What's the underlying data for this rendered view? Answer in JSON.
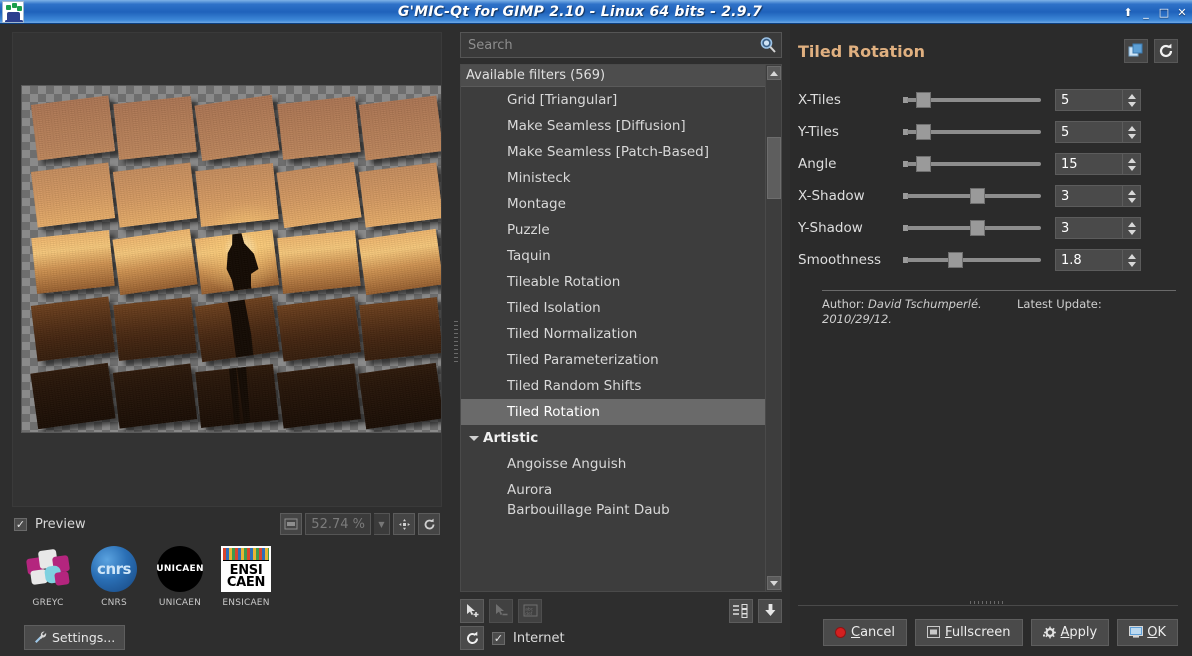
{
  "window": {
    "title": "G'MIC-Qt for GIMP 2.10 - Linux 64 bits - 2.9.7",
    "buttons": {
      "rollup": "⬆",
      "minimize": "_",
      "maximize": "□",
      "close": "✕"
    },
    "app_icon": "gmic-logo-icon"
  },
  "preview": {
    "checkbox_label": "Preview",
    "checked": true,
    "zoom_level": "52.74 %",
    "fit_button": "fit-icon",
    "zoom_in_button": "zoom-in-icon",
    "reset_zoom_button": "reset-zoom-icon"
  },
  "logos": [
    {
      "name": "GREYC",
      "caption": "GREYC"
    },
    {
      "name": "CNRS",
      "caption": "CNRS",
      "text": "cnrs"
    },
    {
      "name": "UNICAEN",
      "caption": "UNICAEN",
      "text": "UNICAEN"
    },
    {
      "name": "ENSICAEN",
      "caption": "ENSICAEN",
      "line1": "ENSI",
      "line2": "CAEN"
    }
  ],
  "settings_button": "Settings...",
  "search": {
    "placeholder": "Search",
    "value": ""
  },
  "filters": {
    "header": "Available filters (569)",
    "items": [
      {
        "label": "Grid [Triangular]",
        "type": "filter",
        "selected": false
      },
      {
        "label": "Make Seamless [Diffusion]",
        "type": "filter",
        "selected": false
      },
      {
        "label": "Make Seamless [Patch-Based]",
        "type": "filter",
        "selected": false
      },
      {
        "label": "Ministeck",
        "type": "filter",
        "selected": false
      },
      {
        "label": "Montage",
        "type": "filter",
        "selected": false
      },
      {
        "label": "Puzzle",
        "type": "filter",
        "selected": false
      },
      {
        "label": "Taquin",
        "type": "filter",
        "selected": false
      },
      {
        "label": "Tileable Rotation",
        "type": "filter",
        "selected": false
      },
      {
        "label": "Tiled Isolation",
        "type": "filter",
        "selected": false
      },
      {
        "label": "Tiled Normalization",
        "type": "filter",
        "selected": false
      },
      {
        "label": "Tiled Parameterization",
        "type": "filter",
        "selected": false
      },
      {
        "label": "Tiled Random Shifts",
        "type": "filter",
        "selected": false
      },
      {
        "label": "Tiled Rotation",
        "type": "filter",
        "selected": true
      },
      {
        "label": "Artistic",
        "type": "category",
        "selected": false
      },
      {
        "label": "Angoisse Anguish",
        "type": "filter",
        "selected": false
      },
      {
        "label": "Aurora",
        "type": "filter",
        "selected": false
      },
      {
        "label": "Barbouillage Paint Daub",
        "type": "filter",
        "selected": false
      }
    ]
  },
  "list_toolbar": {
    "add_favorite": "add-favorite-icon",
    "remove_favorite": "remove-favorite-icon",
    "rename_favorite": "rename-favorite-icon",
    "expand_collapse": "filter-list-icon",
    "update_filters": "download-icon",
    "refresh": "refresh-icon",
    "internet_label": "Internet",
    "internet_checked": true
  },
  "params_panel": {
    "title": "Tiled Rotation",
    "copy_button": "copy-parameters-icon",
    "reset_button": "reset-parameters-icon",
    "parameters": [
      {
        "label": "X-Tiles",
        "value": "5",
        "slider_pct": 6
      },
      {
        "label": "Y-Tiles",
        "value": "5",
        "slider_pct": 6
      },
      {
        "label": "Angle",
        "value": "15",
        "slider_pct": 6
      },
      {
        "label": "X-Shadow",
        "value": "3",
        "slider_pct": 52
      },
      {
        "label": "Y-Shadow",
        "value": "3",
        "slider_pct": 52
      },
      {
        "label": "Smoothness",
        "value": "1.8",
        "slider_pct": 33
      }
    ],
    "credit": {
      "author_label": "Author:",
      "author_name": "David Tschumperlé.",
      "update_label": "Latest Update:",
      "update_date": "2010/29/12."
    }
  },
  "actions": [
    {
      "label": "Cancel",
      "accel": "C",
      "icon": "cancel-icon"
    },
    {
      "label": "Fullscreen",
      "accel": "F",
      "icon": "fullscreen-icon"
    },
    {
      "label": "Apply",
      "accel": "A",
      "icon": "apply-gear-icon"
    },
    {
      "label": "OK",
      "accel": "O",
      "icon": "ok-monitor-icon"
    }
  ]
}
